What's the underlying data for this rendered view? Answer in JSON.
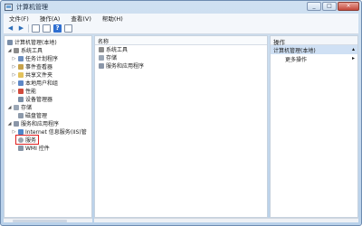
{
  "window": {
    "title": "计算机管理"
  },
  "menubar": {
    "items": [
      "文件(F)",
      "操作(A)",
      "查看(V)",
      "帮助(H)"
    ]
  },
  "tree": {
    "root": "计算机管理(本地)",
    "system_tools": "系统工具",
    "system_children": [
      "任务计划程序",
      "事件查看器",
      "共享文件夹",
      "本地用户和组",
      "性能",
      "设备管理器"
    ],
    "storage": "存储",
    "storage_children": [
      "磁盘管理"
    ],
    "services_apps": "服务和应用程序",
    "services_children": [
      "Internet 信息服务(IIS)管",
      "服务",
      "WMI 控件"
    ]
  },
  "center": {
    "column_header": "名称",
    "items": [
      "系统工具",
      "存储",
      "服务和应用程序"
    ]
  },
  "actions": {
    "header": "操作",
    "selected": "计算机管理(本地)",
    "more": "更多操作"
  },
  "colors": {
    "highlight": "#e02020",
    "selection": "#cfe0f4"
  }
}
